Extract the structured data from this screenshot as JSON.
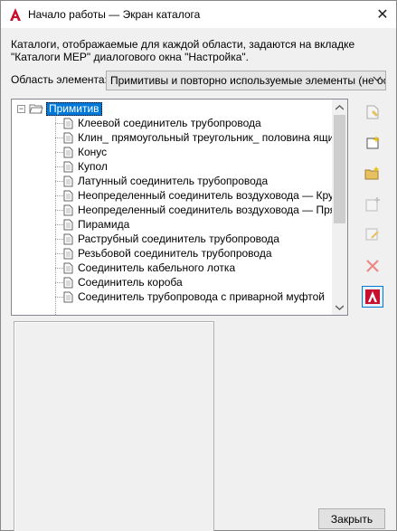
{
  "window": {
    "title": "Начало работы — Экран каталога",
    "close_glyph": "✕"
  },
  "description": "Каталоги, отображаемые для каждой области, задаются на вкладке \"Каталоги MEP\" диалогового окна \"Настройка\".",
  "area": {
    "label": "Область элемента:",
    "selected": "Примитивы и повторно используемые элементы (не осн"
  },
  "tree": {
    "root_label": "Примитив",
    "expander_glyph": "−",
    "items": [
      "Клеевой соединитель трубопровода",
      "Клин_ прямоугольный треугольник_ половина ящика",
      "Конус",
      "Купол",
      "Латунный соединитель трубопровода",
      "Неопределенный соединитель воздуховода — Круглое",
      "Неопределенный соединитель воздуховода — Прямоуго",
      "Пирамида",
      "Раструбный соединитель трубопровода",
      "Резьбовой соединитель трубопровода",
      "Соединитель кабельного лотка",
      "Соединитель короба",
      "Соединитель трубопровода с приварной муфтой"
    ]
  },
  "side_toolbar": {
    "icons": [
      "new-catalog-icon",
      "new-item-icon",
      "open-folder-icon",
      "add-icon",
      "edit-icon",
      "delete-icon",
      "autocad-icon"
    ]
  },
  "footer": {
    "close_label": "Закрыть"
  },
  "colors": {
    "selection": "#0078d7",
    "delete": "#e04040",
    "brand_red": "#c8102e"
  }
}
